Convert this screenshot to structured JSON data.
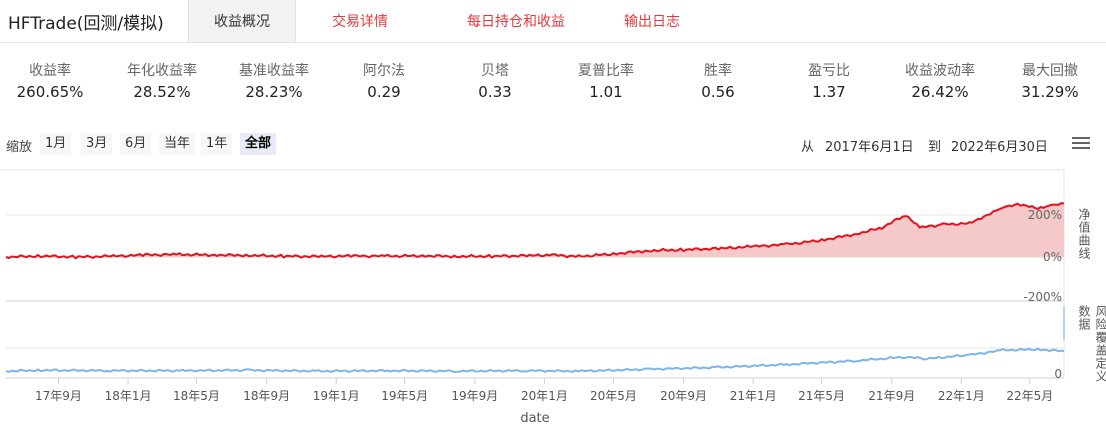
{
  "app_title": "HFTrade(回测/模拟)",
  "tabs": [
    {
      "label": "收益概况",
      "active": true
    },
    {
      "label": "交易详情",
      "active": false
    },
    {
      "label": "每日持仓和收益",
      "active": false
    },
    {
      "label": "输出日志",
      "active": false
    }
  ],
  "stats": [
    {
      "label": "收益率",
      "value": "260.65%"
    },
    {
      "label": "年化收益率",
      "value": "28.52%"
    },
    {
      "label": "基准收益率",
      "value": "28.23%"
    },
    {
      "label": "阿尔法",
      "value": "0.29"
    },
    {
      "label": "贝塔",
      "value": "0.33"
    },
    {
      "label": "夏普比率",
      "value": "1.01"
    },
    {
      "label": "胜率",
      "value": "0.56"
    },
    {
      "label": "盈亏比",
      "value": "1.37"
    },
    {
      "label": "收益波动率",
      "value": "26.42%"
    },
    {
      "label": "最大回撤",
      "value": "31.29%"
    }
  ],
  "zoom": {
    "label": "缩放",
    "buttons": [
      "1月",
      "3月",
      "6月",
      "当年",
      "1年",
      "全部"
    ],
    "selected": "全部"
  },
  "range": {
    "from_label": "从",
    "from": "2017年6月1日",
    "to_label": "到",
    "to": "2022年6月30日"
  },
  "colors": {
    "net_value": "#e8101b",
    "net_fill": "#f5c9c9",
    "risk": "#7cb5ec",
    "accent_blue": "#3366cc",
    "tab_red": "#e4393c"
  },
  "chart_data": [
    {
      "type": "area",
      "x_type": "date",
      "side_label": "净值曲线",
      "ytick_labels": [
        "200%",
        "0%",
        "-200%"
      ],
      "ylim": [
        -200,
        350
      ],
      "xlim": [
        "2017-06-01",
        "2022-06-30"
      ],
      "series": [
        {
          "x": [
            "2017-06-01",
            "2017-08-01",
            "2017-10-01",
            "2017-12-01",
            "2018-02-01",
            "2018-04-01",
            "2018-06-01",
            "2018-08-01",
            "2018-10-01",
            "2018-12-01",
            "2019-02-01",
            "2019-04-01",
            "2019-06-01",
            "2019-08-01",
            "2019-10-01",
            "2019-12-01",
            "2020-01-15",
            "2020-03-01",
            "2020-05-01",
            "2020-07-01",
            "2020-09-01",
            "2020-11-01",
            "2021-01-01",
            "2021-03-01",
            "2021-05-01",
            "2021-07-01",
            "2021-08-15",
            "2021-09-25",
            "2021-10-20",
            "2021-12-01",
            "2022-01-15",
            "2022-02-15",
            "2022-03-15",
            "2022-04-15",
            "2022-05-15",
            "2022-06-10",
            "2022-06-30"
          ],
          "values": [
            0,
            5,
            0,
            3,
            10,
            12,
            10,
            8,
            4,
            2,
            5,
            4,
            6,
            3,
            4,
            6,
            10,
            2,
            15,
            30,
            35,
            40,
            50,
            60,
            80,
            110,
            140,
            200,
            140,
            155,
            160,
            200,
            240,
            250,
            230,
            245,
            255
          ]
        }
      ]
    },
    {
      "type": "area",
      "x_type": "date",
      "side_label": "风险覆盖定义数据",
      "ytick_labels": [
        "0"
      ],
      "xlabel": "date",
      "xtick_labels": [
        "17年9月",
        "18年1月",
        "18年5月",
        "18年9月",
        "19年1月",
        "19年5月",
        "19年9月",
        "20年1月",
        "20年5月",
        "20年9月",
        "21年1月",
        "21年5月",
        "21年9月",
        "22年1月",
        "22年5月"
      ],
      "series": [
        {
          "x": [
            "2017-06-01",
            "2017-08-01",
            "2017-12-01",
            "2018-04-01",
            "2018-08-01",
            "2018-12-01",
            "2019-04-01",
            "2019-08-01",
            "2019-12-01",
            "2020-03-01",
            "2020-07-01",
            "2020-11-01",
            "2021-03-01",
            "2021-07-01",
            "2021-09-25",
            "2021-11-01",
            "2022-01-15",
            "2022-03-15",
            "2022-05-15",
            "2022-06-30"
          ],
          "values": [
            3,
            4,
            3.5,
            3.5,
            4,
            3,
            3.5,
            3,
            3.5,
            3,
            5,
            7,
            10,
            14,
            18,
            16,
            20,
            25,
            26,
            24
          ]
        }
      ]
    }
  ]
}
